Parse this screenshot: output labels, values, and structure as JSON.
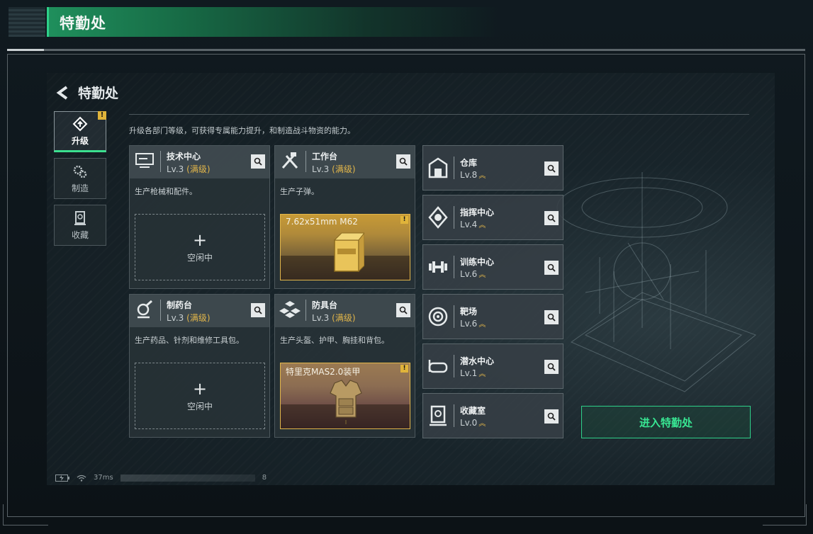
{
  "header": {
    "title": "特勤处"
  },
  "screen": {
    "back_title": "特勤处",
    "description": "升级各部门等级，可获得专属能力提升，和制造战斗物资的能力。",
    "tabs": [
      {
        "label": "升级",
        "icon": "upgrade-icon",
        "active": true,
        "warning": "!"
      },
      {
        "label": "制造",
        "icon": "gears-icon",
        "active": false
      },
      {
        "label": "收藏",
        "icon": "collection-icon",
        "active": false
      }
    ],
    "cards": [
      {
        "name": "技术中心",
        "level": "Lv.3",
        "max": "(满级)",
        "desc": "生产枪械和配件。",
        "icon": "tech-center-icon",
        "slot": {
          "plus": "+",
          "label": "空闲中"
        }
      },
      {
        "name": "工作台",
        "level": "Lv.3",
        "max": "(满级)",
        "desc": "生产子弹。",
        "icon": "workbench-icon",
        "product": {
          "name": "7.62x51mm M62",
          "warning": "!"
        }
      },
      {
        "name": "制药台",
        "level": "Lv.3",
        "max": "(满级)",
        "desc": "生产药品、针剂和维修工具包。",
        "icon": "pharmacy-icon",
        "slot": {
          "plus": "+",
          "label": "空闲中"
        }
      },
      {
        "name": "防具台",
        "level": "Lv.3",
        "max": "(满级)",
        "desc": "生产头盔、护甲、胸挂和背包。",
        "icon": "armor-bench-icon",
        "product": {
          "name": "特里克MAS2.0装甲",
          "warning": "!"
        }
      }
    ],
    "small_cards": [
      {
        "name": "仓库",
        "level": "Lv.8",
        "icon": "warehouse-icon"
      },
      {
        "name": "指挥中心",
        "level": "Lv.4",
        "icon": "command-center-icon"
      },
      {
        "name": "训练中心",
        "level": "Lv.6",
        "icon": "training-center-icon"
      },
      {
        "name": "靶场",
        "level": "Lv.6",
        "icon": "shooting-range-icon"
      },
      {
        "name": "潜水中心",
        "level": "Lv.1",
        "icon": "diving-center-icon"
      },
      {
        "name": "收藏室",
        "level": "Lv.0",
        "icon": "collection-room-icon"
      }
    ],
    "enter_button": "进入特勤处",
    "status": {
      "ping": "37ms",
      "value": "8"
    }
  },
  "colors": {
    "accent_green": "#2ed18a",
    "max_gold": "#e2b64a"
  }
}
